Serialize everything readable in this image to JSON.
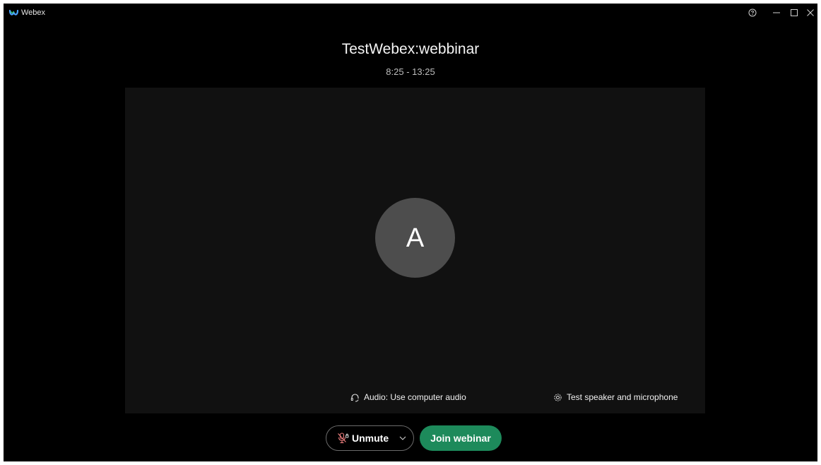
{
  "window": {
    "app_name": "Webex",
    "controls": [
      "help-icon",
      "minimize-icon",
      "maximize-icon",
      "close-icon"
    ]
  },
  "meeting": {
    "title": "TestWebex:webbinar",
    "time": "8:25 - 13:25"
  },
  "preview": {
    "avatar_initial": "A",
    "audio_label": "Audio: Use computer audio",
    "test_label": "Test speaker and microphone"
  },
  "controls": {
    "unmute_label": "Unmute",
    "join_label": "Join webinar"
  },
  "colors": {
    "background": "#000000",
    "preview_bg": "#111111",
    "avatar_bg": "#4d4d4d",
    "join_green": "#1d8a5b",
    "mute_red": "#f08080"
  }
}
